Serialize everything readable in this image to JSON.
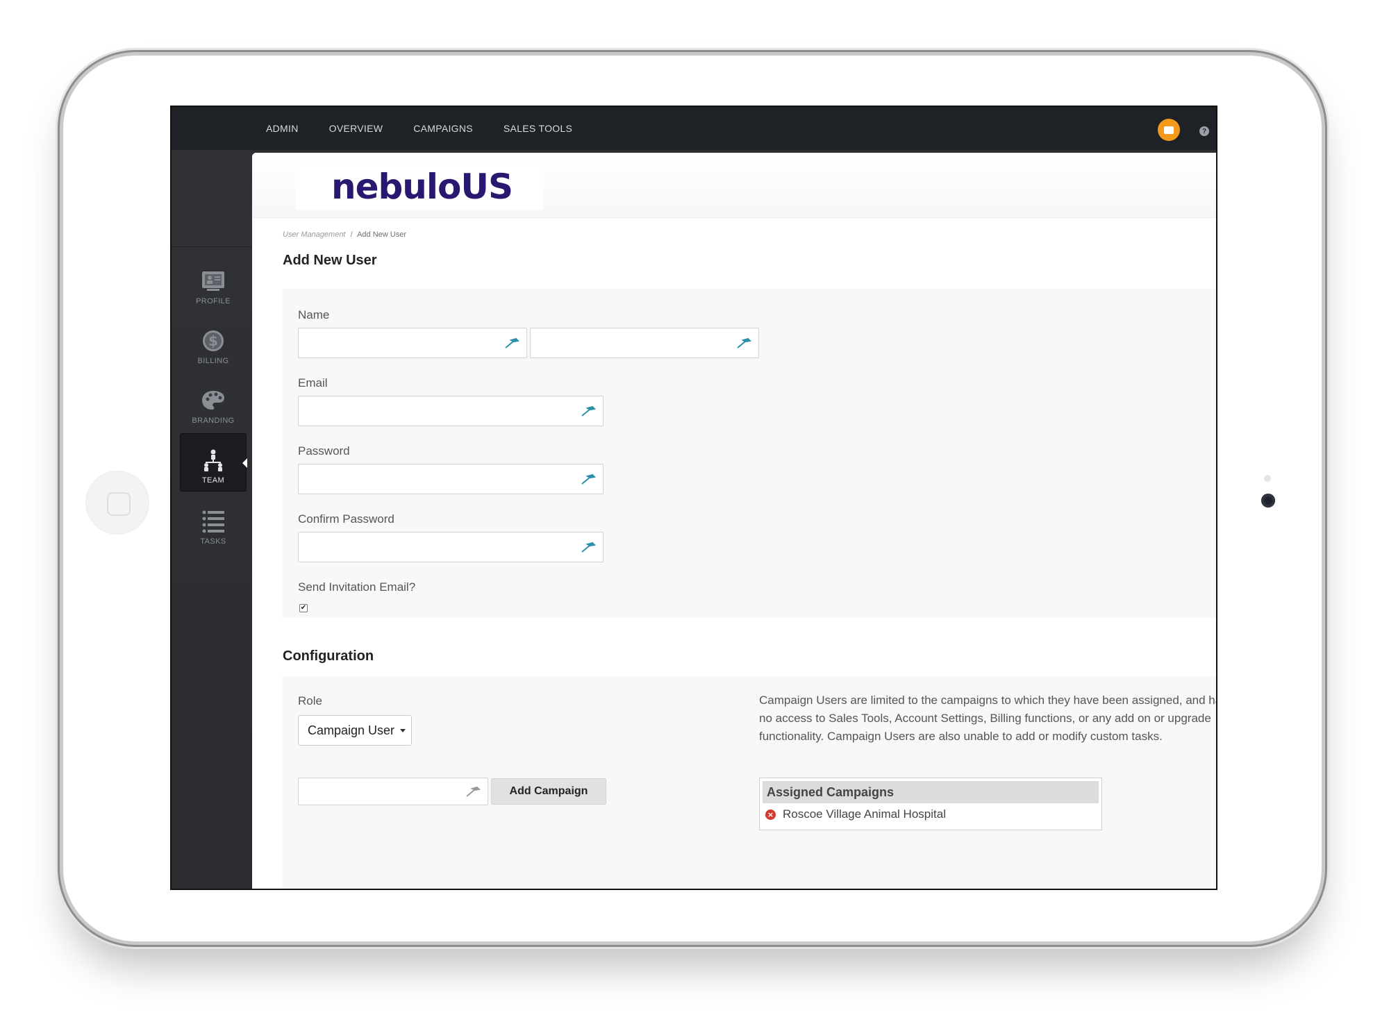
{
  "topnav": {
    "items": [
      "ADMIN",
      "OVERVIEW",
      "CAMPAIGNS",
      "SALES TOOLS"
    ]
  },
  "icons": {
    "notification": "speech-bubble-icon",
    "help": "?"
  },
  "sidebar": {
    "items": [
      {
        "label": "PROFILE",
        "icon": "profile-card-icon"
      },
      {
        "label": "BILLING",
        "icon": "dollar-icon"
      },
      {
        "label": "BRANDING",
        "icon": "palette-icon"
      },
      {
        "label": "TEAM",
        "icon": "team-hierarchy-icon"
      },
      {
        "label": "TASKS",
        "icon": "task-list-icon"
      }
    ]
  },
  "brand": {
    "logo": "nebuloUS"
  },
  "breadcrumb": {
    "parent": "User Management",
    "separator": "/",
    "current": "Add New User"
  },
  "page": {
    "title": "Add New User",
    "config_title": "Configuration"
  },
  "form": {
    "name_label": "Name",
    "email_label": "Email",
    "password_label": "Password",
    "confirm_label": "Confirm Password",
    "invite_label": "Send Invitation Email?",
    "invite_checked": true
  },
  "config": {
    "role_label": "Role",
    "role_value": "Campaign User",
    "add_campaign_button": "Add Campaign",
    "role_description": "Campaign Users are limited to the campaigns to which they have been assigned, and have no access to Sales Tools, Account Settings, Billing functions, or any add on or upgrade functionality. Campaign Users are also unable to add or modify custom tasks.",
    "assigned_header": "Assigned Campaigns",
    "assigned_items": [
      "Roscoe Village Animal Hospital"
    ]
  },
  "colors": {
    "topbar": "#1e2226",
    "sidebar": "#2d2f33",
    "brand": "#2a1770",
    "notification": "#f39a1b",
    "input_icon": "#2a8fa8",
    "remove": "#d23b30"
  }
}
